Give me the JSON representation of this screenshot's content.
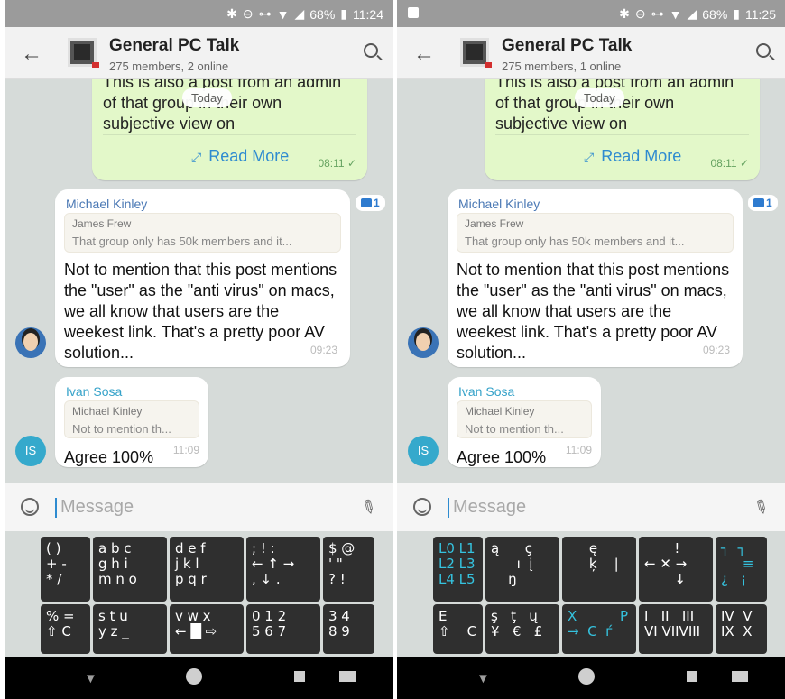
{
  "screens": [
    {
      "status": {
        "battery": "68%",
        "time": "11:24"
      },
      "header": {
        "title": "General PC Talk",
        "subtitle": "275 members, 2 online"
      },
      "chat": {
        "date_chip": "Today",
        "outgoing": {
          "text_lines": [
            "This is also a post from an admin",
            "of that group in their own",
            "subjective view on"
          ],
          "read_more": "Read More",
          "time": "08:11"
        },
        "message1": {
          "sender": "Michael Kinley",
          "quote_name": "James Frew",
          "quote_text": "That group only has 50k members and it...",
          "body": "Not to mention that this post mentions the \"user\" as the \"anti virus\" on macs, we all know that users are the weekest link. That's a pretty poor AV solution...",
          "time": "09:23",
          "likes": "1"
        },
        "message2": {
          "sender": "Ivan Sosa",
          "quote_name": "Michael Kinley",
          "quote_text": "Not to mention th...",
          "body": "Agree 100%",
          "time": "11:09",
          "avatar_initials": "IS"
        }
      },
      "input": {
        "placeholder": "Message"
      },
      "keyboard": {
        "row1": [
          "( )\n+ -\n* /",
          "a b c\ng h i\nm n o",
          "d e f\nj k l\np q r",
          "; ! :\n← ↑ →\n, ↓ .",
          "$ @\n' \"\n? !"
        ],
        "row2": [
          "% =\n⇧ C",
          "s t u\ny z _",
          "v w x\n← █ ⇨",
          "0 1 2\n5 6 7",
          "3 4\n8 9"
        ]
      }
    },
    {
      "status": {
        "battery": "68%",
        "time": "11:25"
      },
      "header": {
        "title": "General PC Talk",
        "subtitle": "275 members, 1 online"
      },
      "chat": {
        "date_chip": "Today",
        "outgoing": {
          "text_lines": [
            "This is also a post from an admin",
            "of that group in their own",
            "subjective view on"
          ],
          "read_more": "Read More",
          "time": "08:11"
        },
        "message1": {
          "sender": "Michael Kinley",
          "quote_name": "James Frew",
          "quote_text": "That group only has 50k members and it...",
          "body": "Not to mention that this post mentions the \"user\" as the \"anti virus\" on macs, we all know that users are the weekest link. That's a pretty poor AV solution...",
          "time": "09:23",
          "likes": "1"
        },
        "message2": {
          "sender": "Ivan Sosa",
          "quote_name": "Michael Kinley",
          "quote_text": "Not to mention th...",
          "body": "Agree 100%",
          "time": "11:09",
          "avatar_initials": "IS"
        }
      },
      "input": {
        "placeholder": "Message"
      },
      "keyboard": {
        "row1": [
          "L0 L1\nL2 L3\nL4 L5",
          "ą      ç\n      ı  į\n    ŋ",
          "     ę\n     ķ    |",
          "       !\n← ✕ →\n       ↓",
          "┐  ┐\n     ≡\n¿   ¡"
        ],
        "row2": [
          "E\n⇧    C",
          "ş   ţ   ų\n¥   €   £",
          "X          P\n→  C  ѓ",
          "I   II   III\nVI VIIVIII",
          "IV  V\nIX  X"
        ]
      }
    }
  ]
}
